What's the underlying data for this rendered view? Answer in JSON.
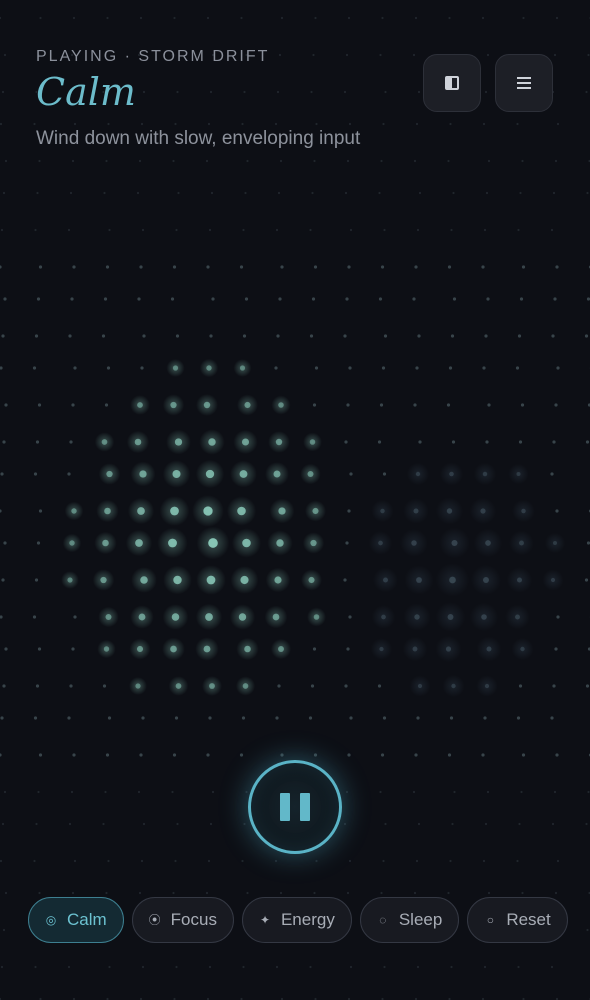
{
  "header": {
    "now_playing": "PLAYING · STORM DRIFT",
    "mode_title": "Calm",
    "mode_description": "Wind down with slow, enveloping input"
  },
  "toolbar": {
    "layout_icon": "half-square-icon",
    "menu_icon": "hamburger-menu-icon"
  },
  "player": {
    "state": "playing",
    "control_icon": "pause-icon"
  },
  "modes": [
    {
      "label": "Calm",
      "icon": "◎",
      "icon_name": "calm-icon",
      "active": true
    },
    {
      "label": "Focus",
      "icon": "⦿",
      "icon_name": "focus-icon",
      "active": false
    },
    {
      "label": "Energy",
      "icon": "✦",
      "icon_name": "energy-icon",
      "active": false
    },
    {
      "label": "Sleep",
      "icon": "◌",
      "icon_name": "sleep-icon",
      "active": false
    },
    {
      "label": "Reset",
      "icon": "○",
      "icon_name": "reset-icon",
      "active": false
    }
  ],
  "colors": {
    "background": "#0d0f15",
    "accent": "#6cbccb",
    "dot_glow": "#8fd1c0",
    "dot_dim": "#3b4a55"
  }
}
